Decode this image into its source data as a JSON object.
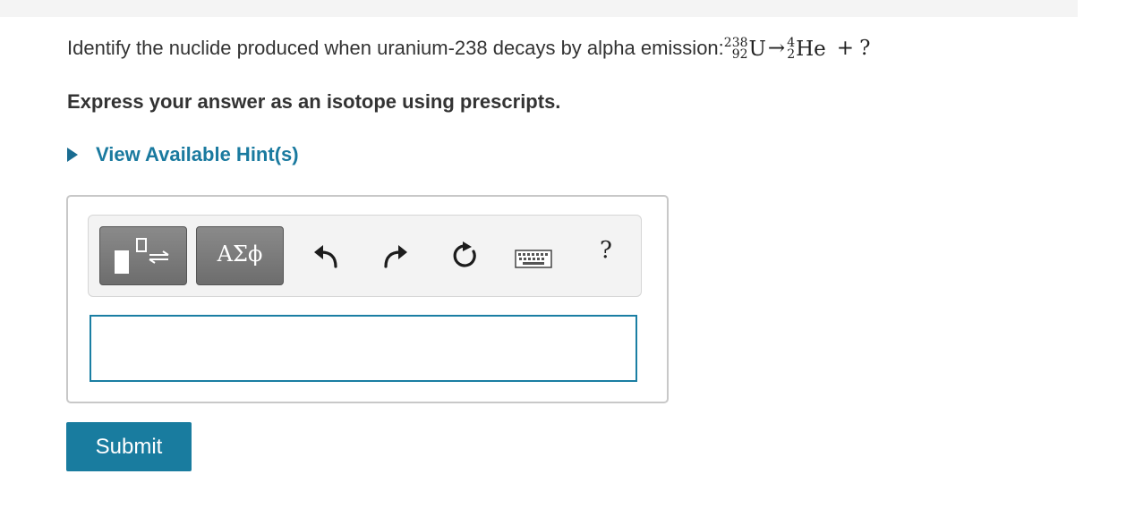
{
  "question": {
    "prompt": "Identify the nuclide produced when uranium-238 decays by alpha emission:",
    "reactant": {
      "mass": "238",
      "atomic": "92",
      "symbol": "U"
    },
    "arrow": "→",
    "product": {
      "mass": "4",
      "atomic": "2",
      "symbol": "He"
    },
    "plus": "+",
    "unknown": "?"
  },
  "instruction": "Express your answer as an isotope using prescripts.",
  "hint": {
    "label": "View Available Hint(s)"
  },
  "toolbar": {
    "greek_label": "ΑΣϕ",
    "help_label": "?"
  },
  "answer_input": {
    "value": ""
  },
  "submit_label": "Submit"
}
